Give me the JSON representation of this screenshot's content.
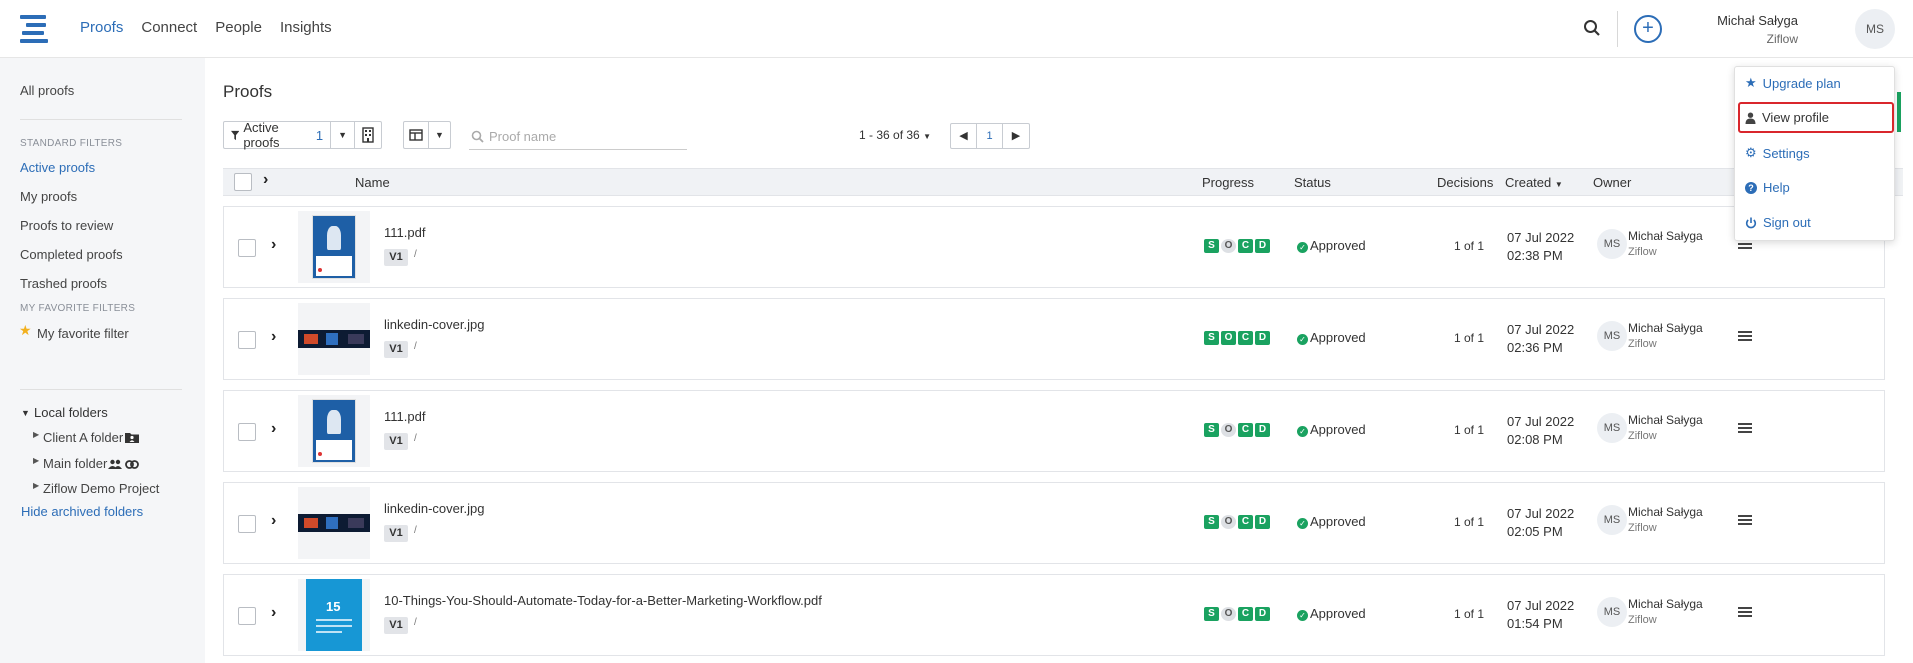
{
  "nav": {
    "items": [
      {
        "label": "Proofs",
        "active": true
      },
      {
        "label": "Connect",
        "active": false
      },
      {
        "label": "People",
        "active": false
      },
      {
        "label": "Insights",
        "active": false
      }
    ]
  },
  "user": {
    "name": "Michał Sałyga",
    "org": "Ziflow",
    "initials": "MS"
  },
  "sidebar": {
    "all_proofs": "All proofs",
    "standard_filters_title": "STANDARD FILTERS",
    "standard_filters": [
      "Active proofs",
      "My proofs",
      "Proofs to review",
      "Completed proofs",
      "Trashed proofs"
    ],
    "favorite_filters_title": "MY FAVORITE FILTERS",
    "favorite_filter": "My favorite filter",
    "local_folders": "Local folders",
    "folders": [
      "Client A folder",
      "Main folder",
      "Ziflow Demo Project"
    ],
    "hide_archived": "Hide archived folders"
  },
  "main": {
    "title": "Proofs",
    "filter_label": "Active proofs",
    "filter_count": "1",
    "search_placeholder": "Proof name",
    "pager_label": "1 - 36 of 36",
    "current_page": "1"
  },
  "table": {
    "headers": {
      "name": "Name",
      "progress": "Progress",
      "status": "Status",
      "decisions": "Decisions",
      "created": "Created",
      "owner": "Owner"
    },
    "progress_letters": [
      "S",
      "O",
      "C",
      "D"
    ],
    "rows": [
      {
        "name": "111.pdf",
        "version": "V1",
        "status": "Approved",
        "decisions": "1 of 1",
        "date": "07 Jul 2022",
        "time": "02:38 PM",
        "owner": "Michał Sałyga",
        "owner_org": "Ziflow",
        "owner_initials": "MS",
        "thumb": "pdf"
      },
      {
        "name": "linkedin-cover.jpg",
        "version": "V1",
        "status": "Approved",
        "decisions": "1 of 1",
        "date": "07 Jul 2022",
        "time": "02:36 PM",
        "owner": "Michał Sałyga",
        "owner_org": "Ziflow",
        "owner_initials": "MS",
        "thumb": "jpg"
      },
      {
        "name": "111.pdf",
        "version": "V1",
        "status": "Approved",
        "decisions": "1 of 1",
        "date": "07 Jul 2022",
        "time": "02:08 PM",
        "owner": "Michał Sałyga",
        "owner_org": "Ziflow",
        "owner_initials": "MS",
        "thumb": "pdf"
      },
      {
        "name": "linkedin-cover.jpg",
        "version": "V1",
        "status": "Approved",
        "decisions": "1 of 1",
        "date": "07 Jul 2022",
        "time": "02:05 PM",
        "owner": "Michał Sałyga",
        "owner_org": "Ziflow",
        "owner_initials": "MS",
        "thumb": "jpg"
      },
      {
        "name": "10-Things-You-Should-Automate-Today-for-a-Better-Marketing-Workflow.pdf",
        "version": "V1",
        "status": "Approved",
        "decisions": "1 of 1",
        "date": "07 Jul 2022",
        "time": "01:54 PM",
        "owner": "Michał Sałyga",
        "owner_org": "Ziflow",
        "owner_initials": "MS",
        "thumb": "cyan",
        "thumb_number": "15"
      }
    ]
  },
  "dropdown": {
    "items": [
      "Upgrade plan",
      "View profile",
      "Settings",
      "Help",
      "Sign out"
    ]
  },
  "colors": {
    "accent": "#2c6db7",
    "success": "#1aa260",
    "highlight": "#d9262c"
  }
}
